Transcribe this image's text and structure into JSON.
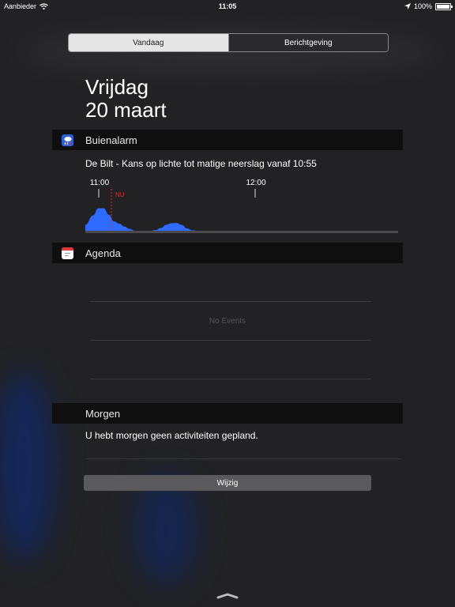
{
  "status_bar": {
    "carrier": "Aanbieder",
    "time": "11:05",
    "battery": "100%"
  },
  "tabs": [
    {
      "label": "Vandaag",
      "active": true
    },
    {
      "label": "Berichtgeving",
      "active": false
    }
  ],
  "date": {
    "day": "Vrijdag",
    "full": "20 maart"
  },
  "buienalarm": {
    "title": "Buienalarm",
    "forecast": "De Bilt - Kans op lichte tot matige neerslag vanaf 10:55",
    "chart_data": {
      "type": "area",
      "time_labels": [
        "11:00",
        "12:00"
      ],
      "now_label": "NU",
      "x_minutes_after_1055": [
        0,
        3,
        5,
        7,
        9,
        11,
        13,
        15,
        17,
        19,
        21,
        23,
        25,
        27,
        29,
        31,
        33,
        35,
        37,
        39,
        41,
        43,
        45,
        50,
        55,
        60,
        65,
        70,
        75,
        80,
        85,
        90,
        95,
        100,
        105,
        110,
        115,
        120
      ],
      "intensity": [
        0.25,
        0.65,
        0.95,
        0.95,
        0.68,
        0.4,
        0.3,
        0.18,
        0.08,
        0,
        0,
        0,
        0,
        0.03,
        0.12,
        0.25,
        0.32,
        0.33,
        0.25,
        0.1,
        0.02,
        0,
        0,
        0,
        0,
        0,
        0,
        0,
        0,
        0,
        0,
        0,
        0,
        0,
        0,
        0,
        0,
        0
      ],
      "color": "#2f6bff",
      "now_color": "#d0302f"
    }
  },
  "agenda": {
    "title": "Agenda",
    "empty_text": "No Events"
  },
  "morgen": {
    "title": "Morgen",
    "text": "U hebt morgen geen activiteiten gepland."
  },
  "edit_button": {
    "label": "Wijzig"
  },
  "colors": {
    "header_bg": "#0f0f10",
    "accent_blue": "#2f6bff",
    "now_red": "#d0302f"
  }
}
